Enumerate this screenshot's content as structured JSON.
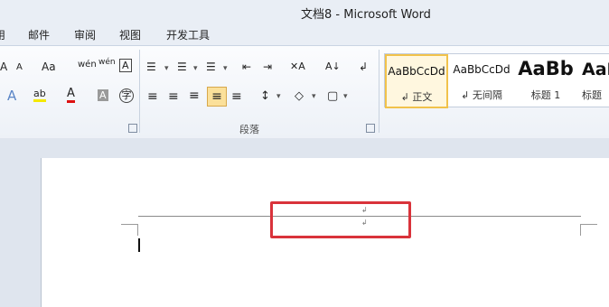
{
  "window": {
    "title": "文档8 - Microsoft Word"
  },
  "menu": {
    "items": [
      "用",
      "邮件",
      "审阅",
      "视图",
      "开发工具"
    ]
  },
  "ribbon": {
    "font": {
      "grow": "A",
      "shrink": "A",
      "case": "Aa",
      "phonetic": "wén",
      "border": "A",
      "effects": "A",
      "highlight": "ab",
      "color": "A",
      "shading": "A",
      "enclose": "字"
    },
    "paragraph": {
      "label": "段落",
      "bullets": "☰",
      "numbering": "☰",
      "multilevel": "☰",
      "decrease_indent": "⇤",
      "increase_indent": "⇥",
      "chinese_layout": "✕A",
      "sort": "A↓",
      "show_marks": "↲",
      "align_left": "≡",
      "center": "≡",
      "align_right": "≡",
      "justify": "≡",
      "distributed": "≡",
      "line_spacing": "↕",
      "shading": "◇",
      "borders": "▢"
    },
    "styles": [
      {
        "preview": "AaBbCcDd",
        "name": "↲ 正文",
        "selected": true
      },
      {
        "preview": "AaBbCcDd",
        "name": "↲ 无间隔",
        "selected": false
      },
      {
        "preview": "AaBb",
        "name": "标题 1",
        "selected": false
      },
      {
        "preview": "AaE",
        "name": "标题",
        "selected": false
      }
    ]
  },
  "document": {
    "header_marks": [
      "↲",
      "↲"
    ]
  },
  "colors": {
    "annotation": "#d9333b",
    "selected_style": "#f1c24b"
  }
}
